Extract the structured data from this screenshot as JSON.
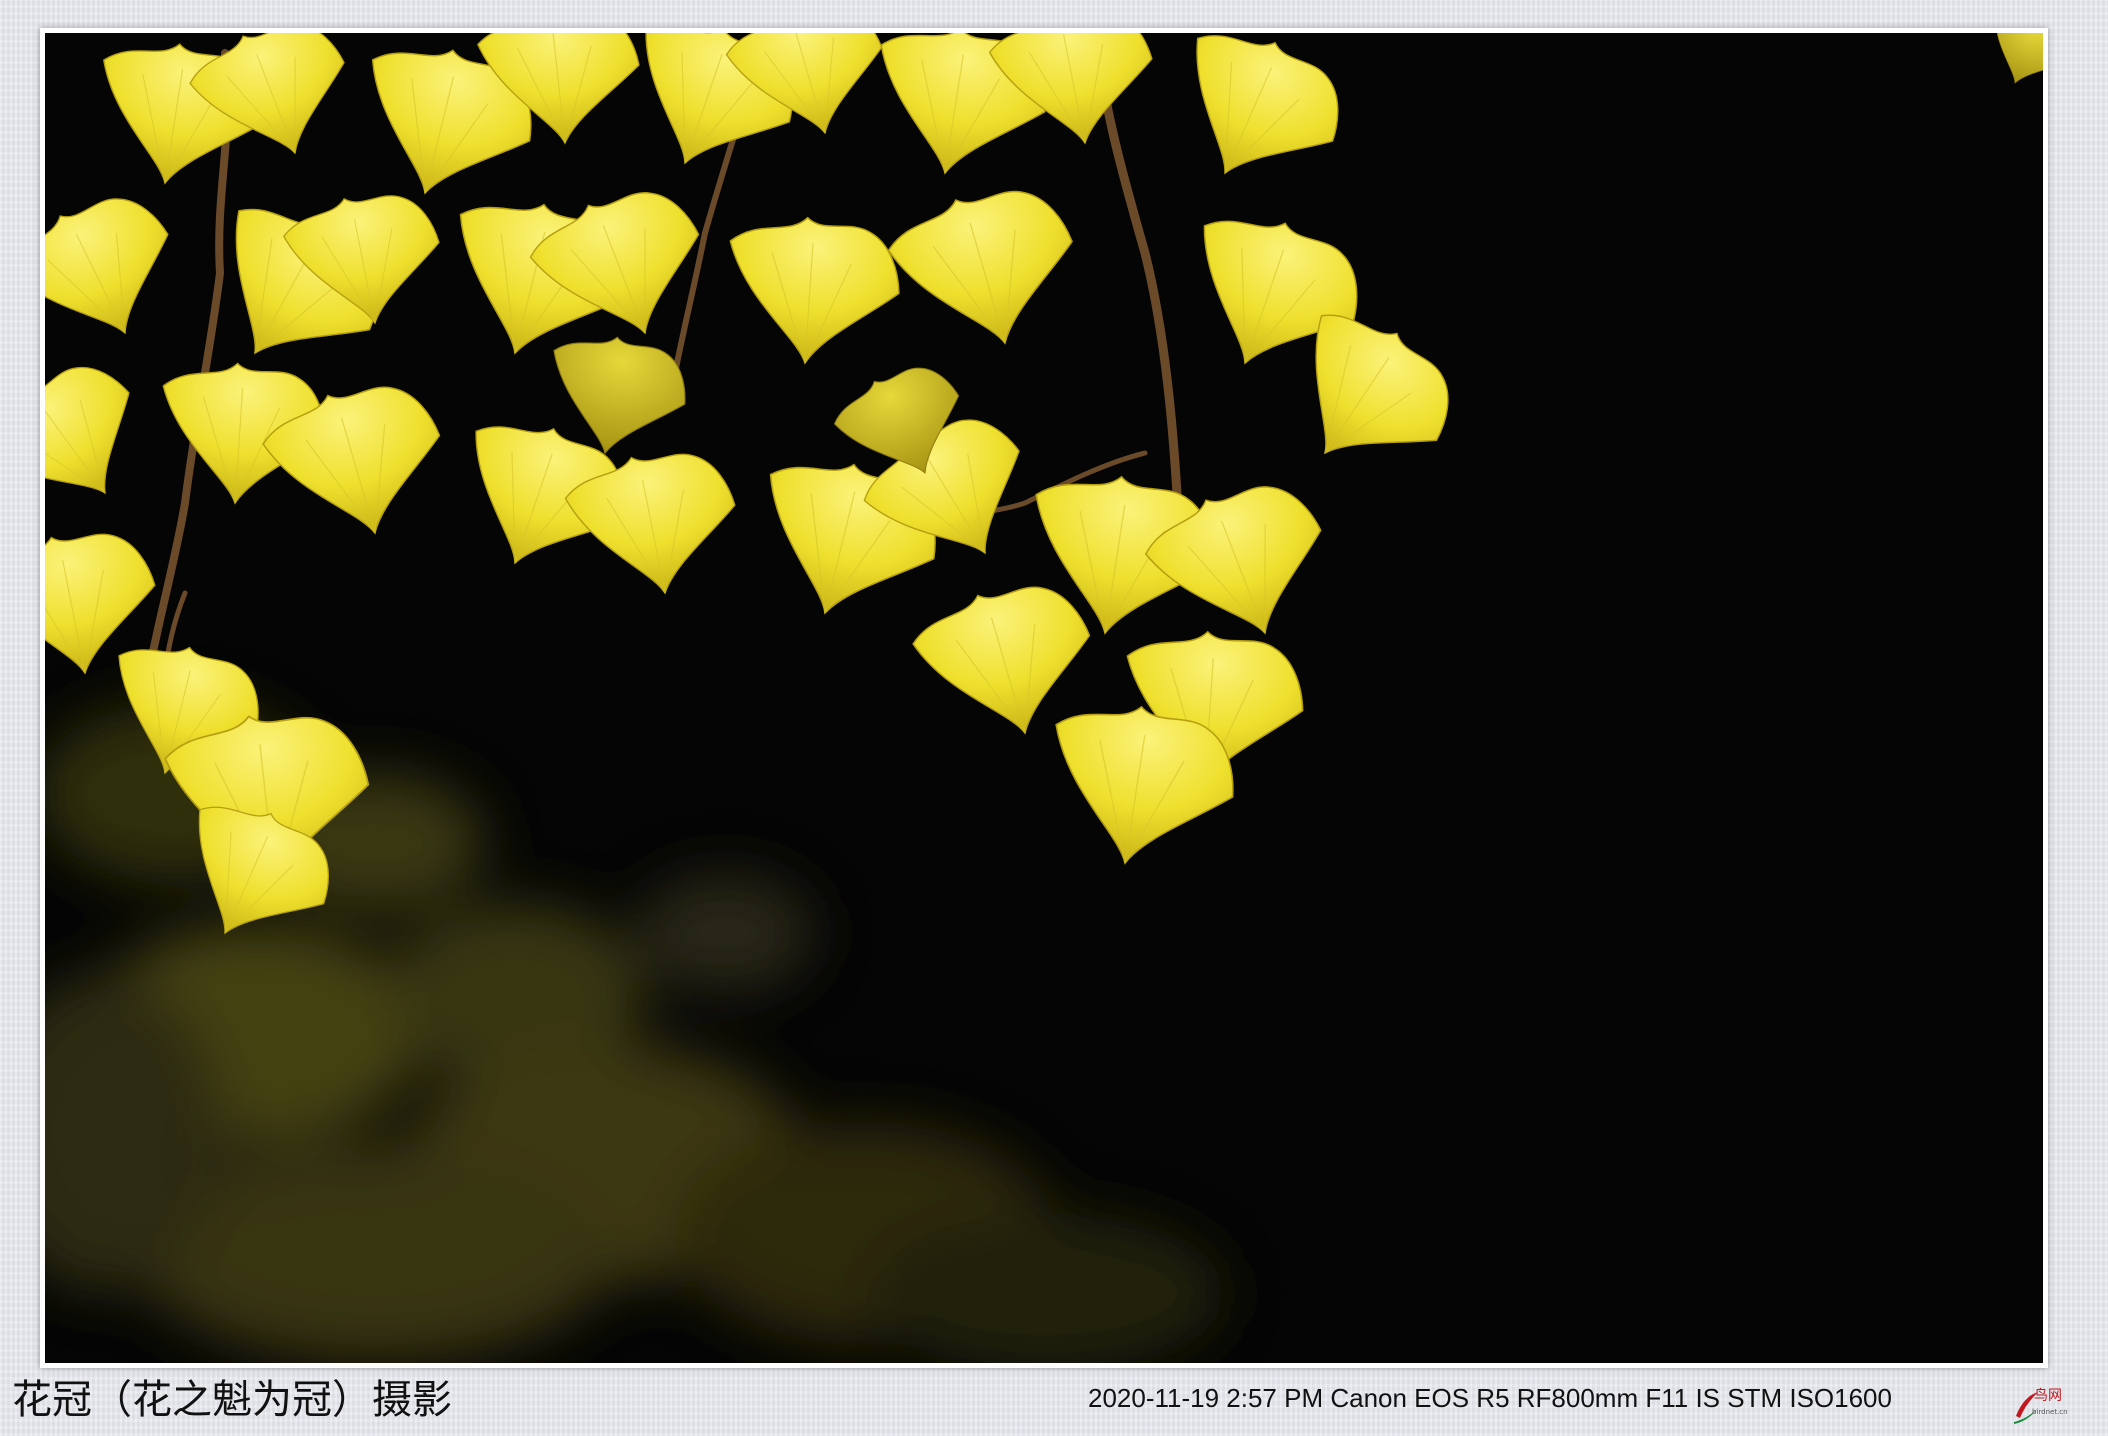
{
  "caption": {
    "photographer_credit": "花冠（花之魁为冠）摄影",
    "exif_info": "2020-11-19  2:57 PM Canon EOS R5  RF800mm F11 IS STM ISO1600"
  },
  "logo": {
    "text": "鸟网",
    "subtext": "birdnet.cn"
  },
  "photo": {
    "subject": "ginkgo-leaves",
    "colors": {
      "background": "#050505",
      "leaf_bright": "#f2e63a",
      "leaf_mid": "#d8c820",
      "leaf_shadow": "#9c8a10",
      "branch": "#6b4a2a",
      "bokeh": "#5a5a1a"
    }
  }
}
